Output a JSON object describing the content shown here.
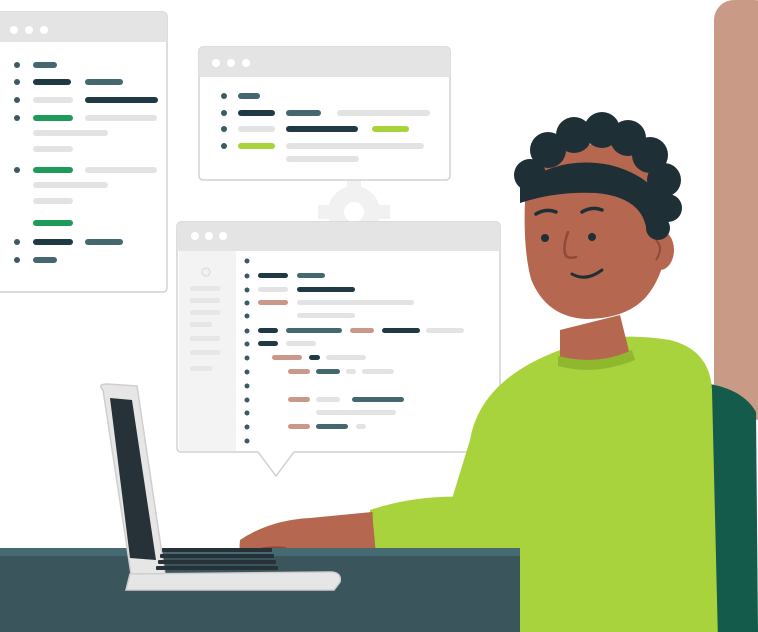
{
  "colors": {
    "background": "#ffffff",
    "window_border": "#cfd2d4",
    "window_titlebar": "#e4e4e4",
    "window_dot": "#ffffff",
    "bullet": "#3a5a64",
    "code_dark": "#1f3a44",
    "code_slate": "#456770",
    "code_light": "#e3e3e3",
    "code_green": "#1e9a5a",
    "code_lime": "#a9d33c",
    "code_tan": "#c9988a",
    "skin": "#b5674f",
    "skin_shadow": "#8e4a37",
    "hair": "#1e2f36",
    "sweater": "#a9d33c",
    "sweater_shadow": "#8fb82e",
    "chair": "#155b4b",
    "desk": "#3a555c",
    "laptop": "#e6e6e6",
    "laptop_screen": "#263238",
    "door": "#c99a86"
  },
  "icons": [
    "gear-icon",
    "window-dots-icon"
  ]
}
